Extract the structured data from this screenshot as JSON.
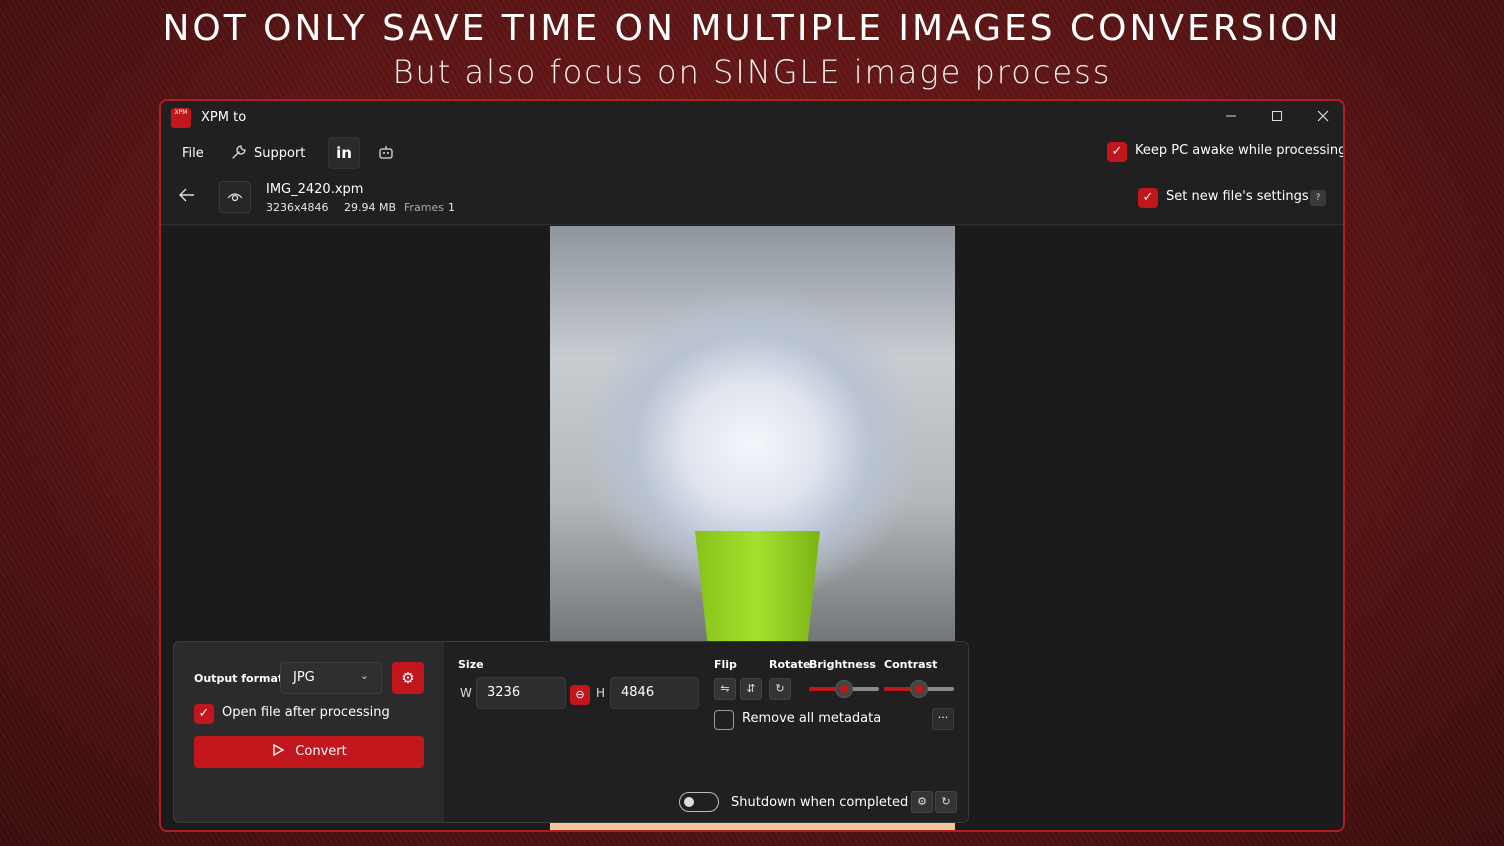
{
  "banner": {
    "headline": "NOT ONLY SAVE TIME ON MULTIPLE IMAGES CONVERSION",
    "subheadline": "But also focus on SINGLE image process"
  },
  "window": {
    "title": "XPM to",
    "logo_text": "XPM"
  },
  "menu": {
    "file_label": "File",
    "support_label": "Support",
    "linkedin_label": "in"
  },
  "options": {
    "keep_awake_label": "Keep PC awake while processing",
    "keep_awake_checked": true,
    "new_file_settings_label": "Set new file's settings",
    "new_file_settings_checked": true,
    "help_label": "?"
  },
  "file": {
    "name": "IMG_2420.xpm",
    "dimensions": "3236x4846",
    "size": "29.94 MB",
    "frames_label": "Frames",
    "frames_value": "1"
  },
  "panel": {
    "output_format_label": "Output format",
    "output_format_value": "JPG",
    "open_after_label": "Open file after processing",
    "open_after_checked": true,
    "convert_label": "Convert",
    "size_label": "Size",
    "width_label": "W",
    "width_value": "3236",
    "height_label": "H",
    "height_value": "4846",
    "flip_label": "Flip",
    "rotate_label": "Rotate",
    "brightness_label": "Brightness",
    "brightness_value": 0.5,
    "contrast_label": "Contrast",
    "contrast_value": 0.5,
    "remove_metadata_label": "Remove all metadata",
    "remove_metadata_checked": false,
    "more_label": "···",
    "shutdown_label": "Shutdown when completed",
    "shutdown_on": false
  },
  "colors": {
    "accent": "#c0161c",
    "window_bg": "#202020",
    "panel_bg": "#2a2a2a"
  }
}
